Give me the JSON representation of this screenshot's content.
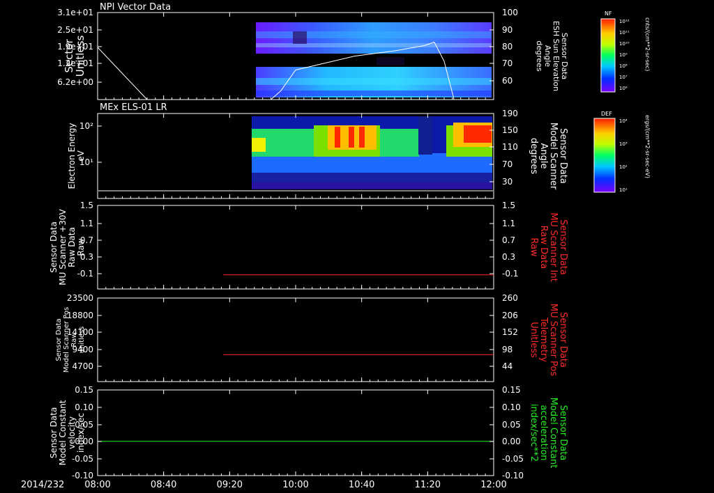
{
  "date_label": "2014/232",
  "time_ticks": [
    "08:00",
    "08:40",
    "09:20",
    "10:00",
    "10:40",
    "11:20",
    "12:00"
  ],
  "colors": {
    "red_axis": "#ff2a2a",
    "green_axis": "#22ee22",
    "white": "#ffffff"
  },
  "colorbars": [
    {
      "label": "NF",
      "units": "cnts/(cm**2-sr-sec)",
      "ticks": [
        "10¹²",
        "10¹¹",
        "10¹⁰",
        "10⁹",
        "10⁸",
        "10⁷",
        "10⁶"
      ]
    },
    {
      "label": "DEF",
      "units": "ergs/(cm**2-sr-sec-eV)",
      "ticks": [
        "10⁴",
        "10³",
        "10²",
        "10¹"
      ]
    }
  ],
  "chart_data": [
    {
      "type": "heatmap",
      "title": "NPI Vector Data",
      "ylabel": [
        "Sector",
        "Unitless"
      ],
      "yticks": [
        "3.1e+01",
        "2.5e+01",
        "1.9e+01",
        "1.2e+01",
        "6.2e+00"
      ],
      "y2label": [
        "Sensor Data",
        "ESH Sun Elevation",
        "Angle",
        "degrees"
      ],
      "y2ticks": [
        "100",
        "90",
        "80",
        "70",
        "60"
      ],
      "y2lim": [
        50,
        100
      ],
      "overlay_line": {
        "x_hours": [
          8.0,
          8.2,
          8.5,
          8.8,
          9.2,
          9.5,
          9.75,
          9.85,
          10.0,
          10.3,
          10.6,
          11.0,
          11.3,
          11.4,
          11.5,
          11.6,
          12.0
        ],
        "values": [
          80,
          68,
          50,
          50,
          50,
          50,
          50,
          55,
          67,
          71,
          75,
          78,
          81,
          83,
          72,
          50,
          50
        ]
      }
    },
    {
      "type": "heatmap",
      "title": "MEx ELS-01 LR",
      "ylabel": [
        "Electron Energy",
        "eV"
      ],
      "yticks": [
        "10²",
        "10¹"
      ],
      "y2label": [
        "Sensor Data",
        "Model Scanner",
        "Angle",
        "degrees"
      ],
      "y2ticks": [
        "190",
        "150",
        "110",
        "70",
        "30"
      ],
      "y2lim": [
        0,
        190
      ]
    },
    {
      "type": "line",
      "ylabel": [
        "Sensor Data",
        "MU Scanner +30V",
        "Raw Data",
        "Raw"
      ],
      "yticks": [
        "1.5",
        "1.1",
        "0.7",
        "0.3",
        "-0.1"
      ],
      "ylim": [
        -0.4,
        1.5
      ],
      "y2label": [
        "Sensor Data",
        "MU Scanner Int",
        "Raw Data",
        "Raw"
      ],
      "y2ticks": [
        "1.5",
        "1.1",
        "0.7",
        "0.3",
        "-0.1"
      ],
      "series": [
        {
          "color": "#ff2a2a",
          "x_hours": [
            9.27,
            12.0
          ],
          "values": [
            -0.08,
            -0.08
          ]
        }
      ]
    },
    {
      "type": "line",
      "ylabel": [
        "Sensor Data",
        "Model Scanner Pos",
        "Raw",
        "unitless"
      ],
      "yticks": [
        "23500",
        "18800",
        "14100",
        "9400",
        "4700"
      ],
      "ylim": [
        0,
        23500
      ],
      "y2label": [
        "Sensor Data",
        "MU Scanner Pos",
        "Telemetry",
        "Unitless"
      ],
      "y2ticks": [
        "260",
        "206",
        "152",
        "98",
        "44"
      ],
      "y2lim": [
        0,
        260
      ],
      "series": [
        {
          "color": "#ff2a2a",
          "x_hours": [
            9.27,
            12.0
          ],
          "values": [
            84,
            84
          ],
          "axis": "right"
        }
      ]
    },
    {
      "type": "line",
      "ylabel": [
        "Sensor Data",
        "Model Constant",
        "velocity",
        "index/sec"
      ],
      "yticks": [
        "0.15",
        "0.10",
        "0.05",
        "0.00",
        "-0.05",
        "-0.10"
      ],
      "ylim": [
        -0.1,
        0.15
      ],
      "y2label": [
        "Sensor Data",
        "Model Constant",
        "acceleration",
        "index/sec**2"
      ],
      "y2ticks": [
        "0.15",
        "0.10",
        "0.05",
        "0.00",
        "-0.05",
        "-0.10"
      ],
      "series": [
        {
          "color": "#22ee22",
          "x_hours": [
            8.0,
            12.0
          ],
          "values": [
            0.0,
            0.0
          ]
        }
      ]
    }
  ]
}
